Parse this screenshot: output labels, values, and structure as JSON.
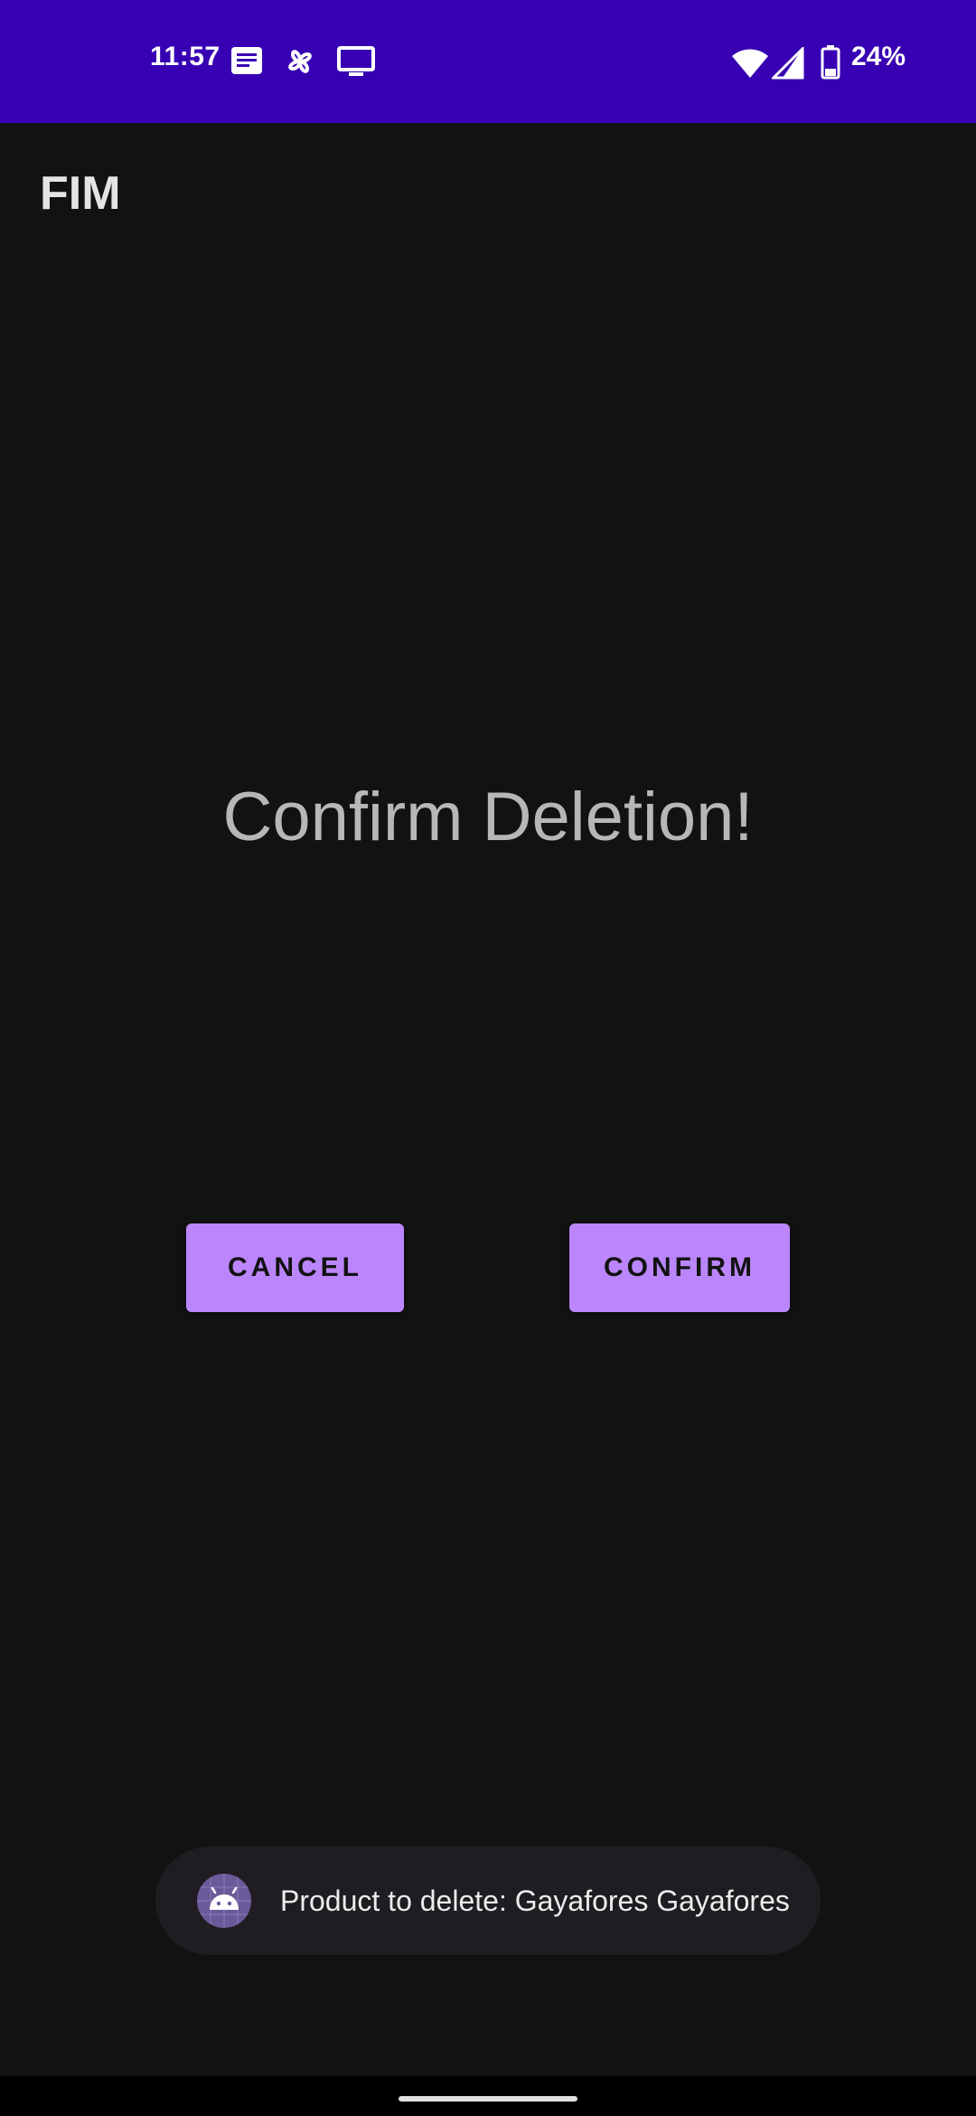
{
  "status_bar": {
    "time": "11:57",
    "battery_percent": "24%",
    "background_color": "#3700b3",
    "icons": [
      "notification-icon",
      "pinwheel-icon",
      "cast-screen-icon",
      "wifi-icon",
      "signal-icon",
      "battery-icon"
    ]
  },
  "app_bar": {
    "title": "FIM"
  },
  "main": {
    "heading": "Confirm Deletion!",
    "cancel_label": "CANCEL",
    "confirm_label": "CONFIRM",
    "button_color": "#bb86fc"
  },
  "toast": {
    "message": "Product to delete: Gayafores Gayafores",
    "icon": "android-icon"
  },
  "colors": {
    "background": "#121212",
    "accent": "#bb86fc",
    "status_bar": "#3700b3"
  }
}
